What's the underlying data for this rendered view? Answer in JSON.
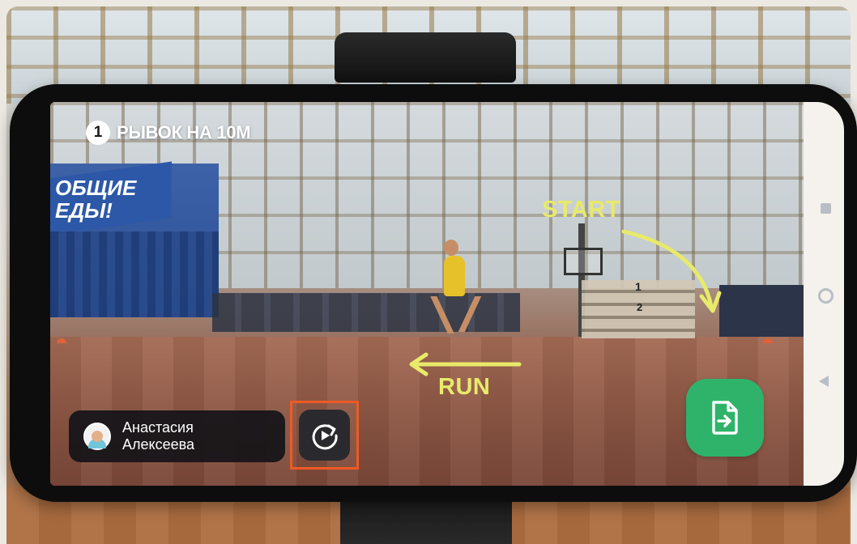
{
  "exercise": {
    "step_number": "1",
    "title": "РЫВОК НА 10М"
  },
  "scene": {
    "banner_text_line1": "ОБЩИЕ",
    "banner_text_line2": "ЕДЫ!",
    "box_number_1": "1",
    "box_number_2": "2"
  },
  "overlay": {
    "start_label": "START",
    "run_label": "RUN",
    "accent_color": "#e8ea6a"
  },
  "user": {
    "first_name": "Анастасия",
    "last_name": "Алексеева"
  },
  "controls": {
    "replay_icon": "replay-icon",
    "export_icon": "file-export-icon",
    "highlight_color": "#ef5a24",
    "export_color": "#2fb36a"
  },
  "android_nav": {
    "recents_icon": "square-icon",
    "home_icon": "circle-icon",
    "back_icon": "triangle-back-icon"
  }
}
